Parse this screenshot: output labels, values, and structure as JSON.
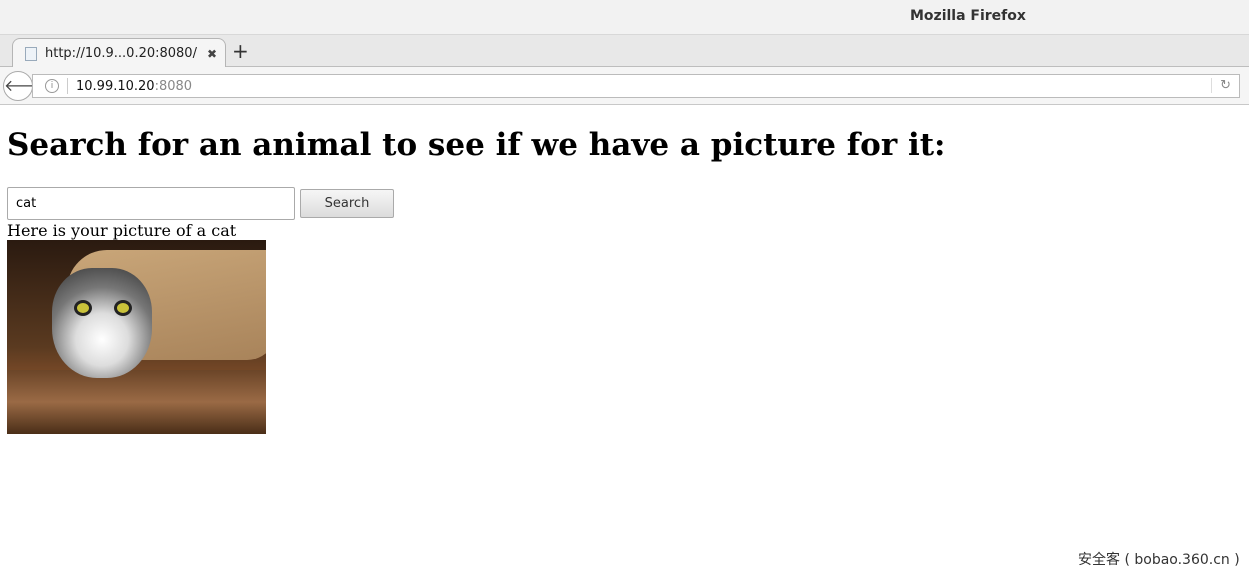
{
  "window": {
    "title": "Mozilla Firefox"
  },
  "tabs": [
    {
      "label": "http://10.9...0.20:8080/",
      "close_icon": "close-icon"
    }
  ],
  "new_tab_label": "+",
  "address_bar": {
    "host": "10.99.10.20",
    "port": ":8080"
  },
  "page": {
    "heading": "Search for an animal to see if we have a picture for it:",
    "search": {
      "value": "cat",
      "placeholder": ""
    },
    "search_button": "Search",
    "result_text": "Here is your picture of a cat",
    "image_subject": "cat"
  },
  "watermark": "安全客 ( bobao.360.cn )"
}
